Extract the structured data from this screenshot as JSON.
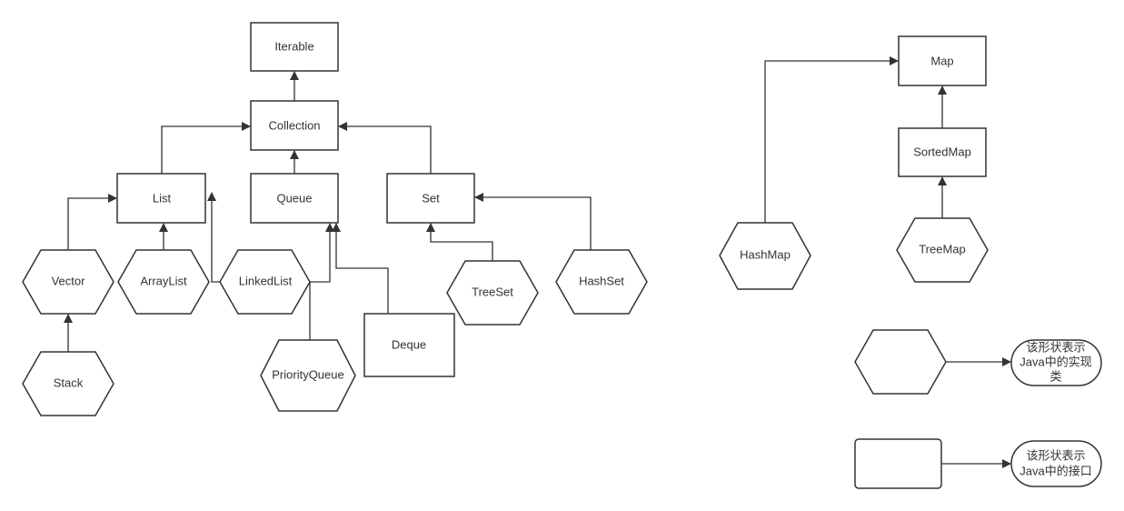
{
  "interfaces": {
    "iterable": "Iterable",
    "collection": "Collection",
    "list": "List",
    "queue": "Queue",
    "set": "Set",
    "deque": "Deque",
    "map": "Map",
    "sorted_map": "SortedMap"
  },
  "classes": {
    "vector": "Vector",
    "array_list": "ArrayList",
    "linked_list": "LinkedList",
    "stack": "Stack",
    "priority_queue": "PriorityQueue",
    "tree_set": "TreeSet",
    "hash_set": "HashSet",
    "hash_map": "HashMap",
    "tree_map": "TreeMap"
  },
  "legend": {
    "class_line1": "该形状表示",
    "class_line2": "Java中的实现",
    "class_line3": "类",
    "interface_line1": "该形状表示",
    "interface_line2": "Java中的接口"
  },
  "colors": {
    "stroke": "#333333",
    "background": "#ffffff"
  }
}
